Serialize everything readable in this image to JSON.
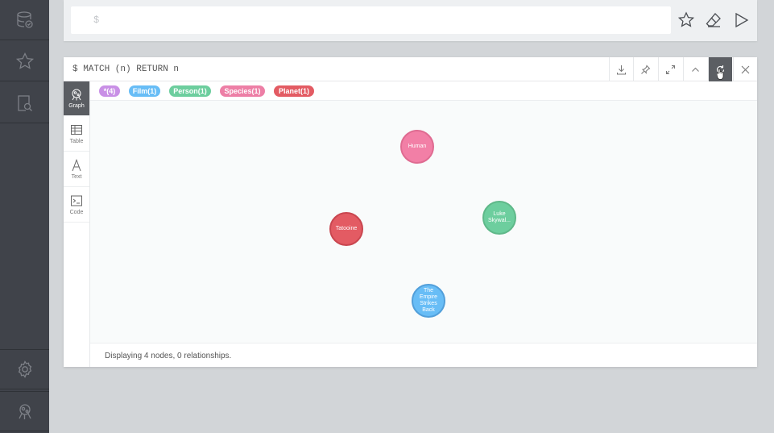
{
  "sidebar": {
    "items": [
      {
        "icon": "database-icon"
      },
      {
        "icon": "star-icon"
      },
      {
        "icon": "search-document-icon"
      },
      {
        "icon": "gear-icon"
      },
      {
        "icon": "neo4j-logo-icon"
      }
    ],
    "bg": "#40434a"
  },
  "editor": {
    "prompt": "$",
    "actions": [
      "favorite-star-icon",
      "eraser-icon",
      "run-play-icon"
    ]
  },
  "frame": {
    "query": "$ MATCH (n) RETURN n",
    "actions": [
      "download-icon",
      "pin-icon",
      "fullscreen-icon",
      "collapse-icon",
      "retry-icon",
      "close-icon"
    ],
    "tabs": [
      {
        "label": "Graph",
        "icon": "graph-icon",
        "active": true
      },
      {
        "label": "Table",
        "icon": "table-icon",
        "active": false
      },
      {
        "label": "Text",
        "icon": "text-icon",
        "active": false
      },
      {
        "label": "Code",
        "icon": "code-icon",
        "active": false
      }
    ],
    "labels": [
      {
        "text": "*(4)",
        "color": "#c990e6"
      },
      {
        "text": "Film(1)",
        "color": "#68bdf6"
      },
      {
        "text": "Person(1)",
        "color": "#6dce9e"
      },
      {
        "text": "Species(1)",
        "color": "#ed7fa6"
      },
      {
        "text": "Planet(1)",
        "color": "#e35b63"
      }
    ],
    "nodes": [
      {
        "name": "Human",
        "color": "#f27fa6",
        "border": "#df6b91"
      },
      {
        "name": "Luke Skywal...",
        "color": "#6dce9e",
        "border": "#5fb889"
      },
      {
        "name": "Tatooine",
        "color": "#e35b63",
        "border": "#c9464f"
      },
      {
        "name": "The Empire Strikes Back",
        "color": "#68bdf6",
        "border": "#529fda"
      }
    ],
    "status": "Displaying 4 nodes, 0 relationships."
  }
}
